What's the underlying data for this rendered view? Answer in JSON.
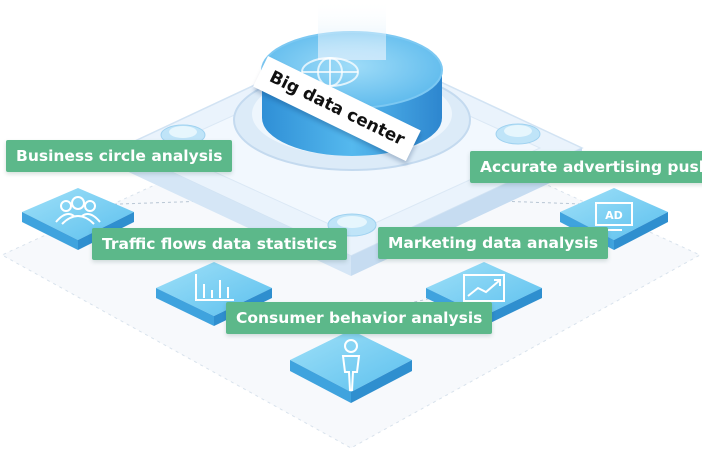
{
  "center": {
    "label": "Big data center"
  },
  "modules": [
    {
      "id": "business",
      "label": "Business circle analysis",
      "icon": "people-icon"
    },
    {
      "id": "traffic",
      "label": "Traffic flows data statistics",
      "icon": "bar-chart-icon"
    },
    {
      "id": "consumer",
      "label": "Consumer behavior analysis",
      "icon": "person-icon"
    },
    {
      "id": "marketing",
      "label": "Marketing data analysis",
      "icon": "trend-chart-icon"
    },
    {
      "id": "ads",
      "label": "Accurate advertising push",
      "icon": "ad-monitor-icon",
      "icon_text": "AD"
    }
  ],
  "colors": {
    "label_bg": "#5cb88a",
    "tile_top": "#7fd0f2",
    "tile_side": "#3aa0dc",
    "cylinder": "#4fb3ec",
    "platform": "#e4f0fb"
  }
}
